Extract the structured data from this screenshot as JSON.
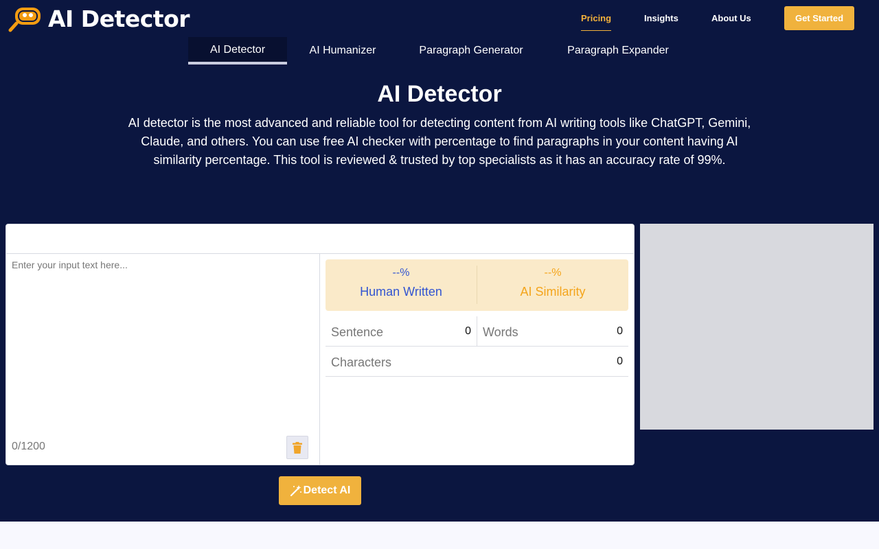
{
  "brand": {
    "name": "AI Detector",
    "logo_icon": "magnifier-robot-logo"
  },
  "nav": {
    "items": [
      {
        "label": "Pricing",
        "active": true
      },
      {
        "label": "Insights",
        "active": false
      },
      {
        "label": "About Us",
        "active": false
      }
    ],
    "cta_label": "Get Started"
  },
  "tabs": [
    {
      "label": "AI Detector",
      "active": true
    },
    {
      "label": "AI Humanizer",
      "active": false
    },
    {
      "label": "Paragraph Generator",
      "active": false
    },
    {
      "label": "Paragraph Expander",
      "active": false
    }
  ],
  "hero": {
    "title": "AI Detector",
    "description": "AI detector is the most advanced and reliable tool for detecting content from AI writing tools like ChatGPT, Gemini, Claude, and others. You can use free AI checker with percentage to find paragraphs in your content having AI similarity percentage. This tool is reviewed & trusted by top specialists as it has an accuracy rate of 99%."
  },
  "editor": {
    "placeholder": "Enter your input text here...",
    "counter": "0/1200",
    "clear_icon": "trash-icon"
  },
  "results": {
    "human": {
      "percent": "--%",
      "label": "Human Written"
    },
    "ai": {
      "percent": "--%",
      "label": "AI Similarity"
    },
    "stats": {
      "sentence": {
        "label": "Sentence",
        "value": "0"
      },
      "words": {
        "label": "Words",
        "value": "0"
      },
      "characters": {
        "label": "Characters",
        "value": "0"
      }
    }
  },
  "detect_button": {
    "label": "Detect AI",
    "icon": "magic-wand-icon"
  },
  "colors": {
    "background": "#0b1640",
    "accent": "#f0b23d",
    "human": "#3355d1",
    "ai": "#f4a51c",
    "score_bg": "#faeac9"
  }
}
